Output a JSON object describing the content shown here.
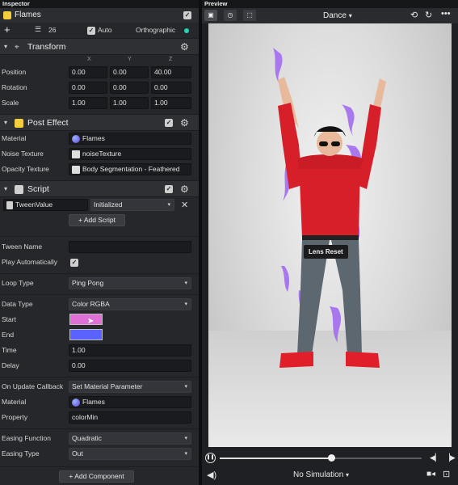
{
  "inspector": {
    "panel_title": "Inspector",
    "object_name": "Flames",
    "render_order": "26",
    "auto_label": "Auto",
    "camera_mode": "Orthographic",
    "transform": {
      "title": "Transform",
      "axes": [
        "X",
        "Y",
        "Z"
      ],
      "rows": [
        {
          "label": "Position",
          "values": [
            "0.00",
            "0.00",
            "40.00"
          ]
        },
        {
          "label": "Rotation",
          "values": [
            "0.00",
            "0.00",
            "0.00"
          ]
        },
        {
          "label": "Scale",
          "values": [
            "1.00",
            "1.00",
            "1.00"
          ]
        }
      ]
    },
    "post_effect": {
      "title": "Post Effect",
      "material_label": "Material",
      "material_value": "Flames",
      "noise_label": "Noise Texture",
      "noise_value": "noiseTexture",
      "opacity_label": "Opacity Texture",
      "opacity_value": "Body Segmentation - Feathered"
    },
    "script": {
      "title": "Script",
      "script_name": "TweenValue",
      "event_value": "Initialized",
      "add_script_label": "Add Script"
    },
    "tween": {
      "tween_name_label": "Tween Name",
      "tween_name_value": "",
      "play_auto_label": "Play Automatically",
      "loop_type_label": "Loop Type",
      "loop_type_value": "Ping Pong",
      "data_type_label": "Data Type",
      "data_type_value": "Color RGBA",
      "start_label": "Start",
      "start_color": "#e070d6",
      "end_label": "End",
      "end_color": "#5a62ff",
      "time_label": "Time",
      "time_value": "1.00",
      "delay_label": "Delay",
      "delay_value": "0.00",
      "callback_label": "On Update Callback",
      "callback_value": "Set Material Parameter",
      "cb_material_label": "Material",
      "cb_material_value": "Flames",
      "property_label": "Property",
      "property_value": "colorMin",
      "easing_fn_label": "Easing Function",
      "easing_fn_value": "Quadratic",
      "easing_type_label": "Easing Type",
      "easing_type_value": "Out"
    },
    "add_component_label": "Add Component"
  },
  "preview": {
    "panel_title": "Preview",
    "animation_value": "Dance",
    "tooltip": "Lens Reset",
    "simulation_value": "No Simulation",
    "playback_progress": 0.55
  },
  "colors": {
    "accent_teal": "#2ad1b8",
    "post_effect_icon": "#f5cf3b",
    "flame_purple": "#a36cf0",
    "shirt_red": "#d71f2a"
  }
}
